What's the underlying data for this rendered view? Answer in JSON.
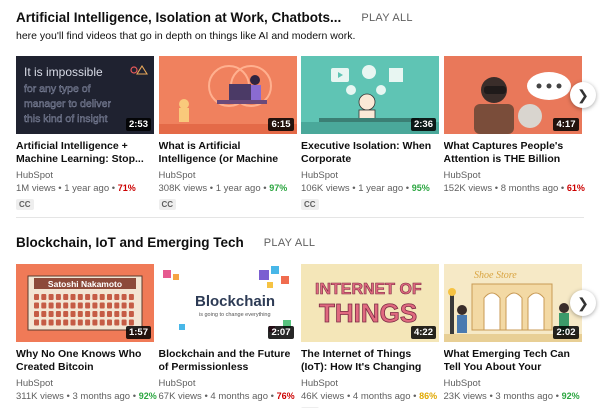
{
  "shelves": [
    {
      "title": "Artificial Intelligence, Isolation at Work, Chatbots...",
      "play_all": "PLAY ALL",
      "description": "here you'll find videos that go in depth on things like AI and modern work.",
      "videos": [
        {
          "title": "Artificial Intelligence + Machine Learning: Stop...",
          "channel": "HubSpot",
          "views": "1M views",
          "age": "1 year ago",
          "rating": "71%",
          "rating_color": "#cc0000",
          "duration": "2:53",
          "cc": "CC",
          "thumb_text": [
            "It is impossible",
            "for any type of",
            "manager to deliver",
            "this kind of insight"
          ]
        },
        {
          "title": "What is Artificial Intelligence (or Machine Learning)?",
          "channel": "HubSpot",
          "views": "308K views",
          "age": "1 year ago",
          "rating": "97%",
          "rating_color": "#2ba640",
          "duration": "6:15",
          "cc": "CC"
        },
        {
          "title": "Executive Isolation: When Corporate Communication...",
          "channel": "HubSpot",
          "views": "106K views",
          "age": "1 year ago",
          "rating": "95%",
          "rating_color": "#2ba640",
          "duration": "2:36",
          "cc": "CC"
        },
        {
          "title": "What Captures People's Attention is THE Billion Doll...",
          "channel": "HubSpot",
          "views": "152K views",
          "age": "8 months ago",
          "rating": "61%",
          "rating_color": "#cc0000",
          "duration": "4:17",
          "cc": ""
        }
      ]
    },
    {
      "title": "Blockchain, IoT and Emerging Tech",
      "play_all": "PLAY ALL",
      "videos": [
        {
          "title": "Why No One Knows Who Created Bitcoin",
          "channel": "HubSpot",
          "views": "311K views",
          "age": "3 months ago",
          "rating": "92%",
          "rating_color": "#2ba640",
          "duration": "1:57",
          "cc": "",
          "thumb_text": [
            "Satoshi Nakamoto"
          ]
        },
        {
          "title": "Blockchain and the Future of Permissionless Innovation",
          "channel": "HubSpot",
          "views": "67K views",
          "age": "4 months ago",
          "rating": "76%",
          "rating_color": "#cc0000",
          "duration": "2:07",
          "cc": "",
          "thumb_text": [
            "Blockchain",
            "is going to change everything"
          ]
        },
        {
          "title": "The Internet of Things (IoT): How It's Changing Custome...",
          "channel": "HubSpot",
          "views": "46K views",
          "age": "4 months ago",
          "rating": "86%",
          "rating_color": "#e0a800",
          "duration": "4:22",
          "cc": "CC",
          "thumb_text": [
            "INTERNET OF",
            "THINGS"
          ]
        },
        {
          "title": "What Emerging Tech Can Tell You About Your Customers",
          "channel": "HubSpot",
          "views": "23K views",
          "age": "3 months ago",
          "rating": "92%",
          "rating_color": "#2ba640",
          "duration": "2:02",
          "cc": "",
          "thumb_text": [
            "Shoe Store"
          ]
        }
      ]
    }
  ],
  "next_icon": "chevron-right-icon",
  "separator": "•"
}
